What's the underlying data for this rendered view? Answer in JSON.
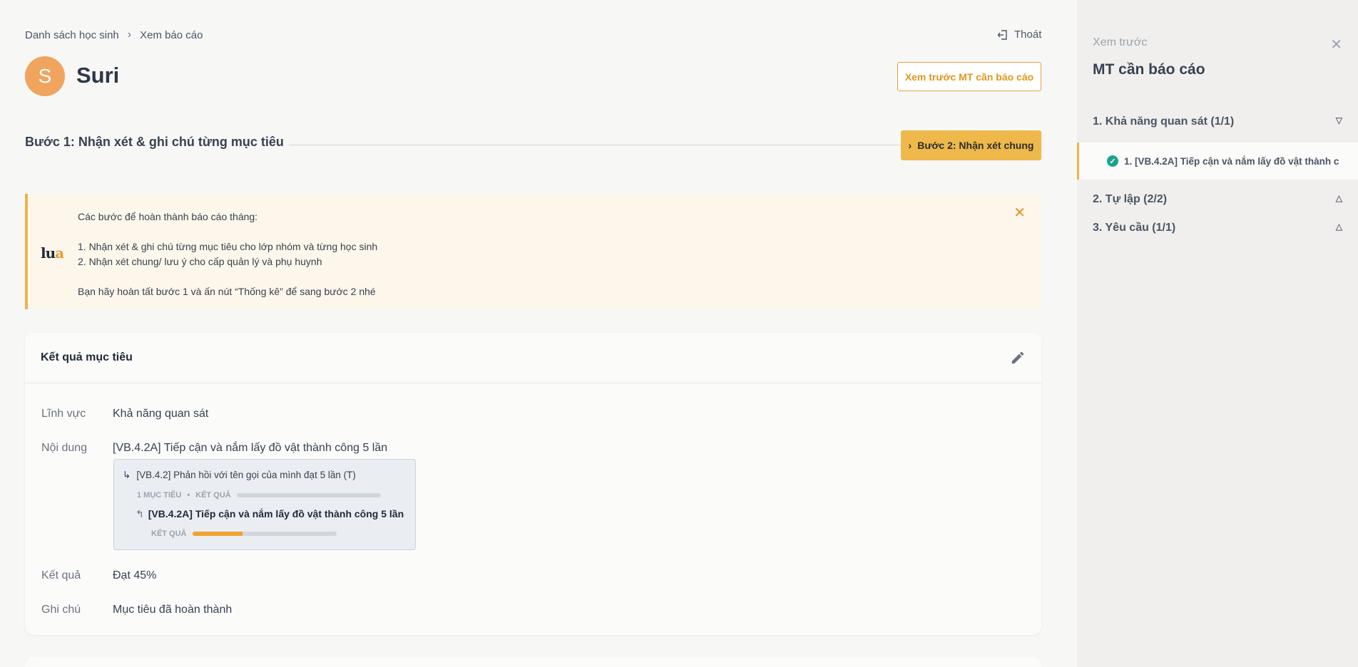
{
  "breadcrumb": {
    "items": [
      "Danh sách học sinh",
      "Xem báo cáo"
    ],
    "separator": "›"
  },
  "header": {
    "logout_label": "Thoát",
    "avatar_initial": "S",
    "student_name": "Suri",
    "preview_button": "Xem trước MT cần báo cáo"
  },
  "steps": {
    "step1_title": "Bước 1: Nhận xét & ghi chú từng mục tiêu",
    "step2_button": "Bước 2: Nhận xét chung"
  },
  "notice": {
    "intro": "Các bước để hoàn thành báo cáo tháng:",
    "item1": "1. Nhận xét & ghi chú từng mục tiêu cho lớp nhóm và từng học sinh",
    "item2": "2. Nhận xét chung/ lưu ý cho cấp quản lý và phụ huynh",
    "outro": "Bạn hãy hoàn tất bước 1 và ấn nút “Thống kê” để sang bước 2 nhé",
    "logo_part1": "lu",
    "logo_part2": "a"
  },
  "result_card": {
    "title": "Kết quả mục tiêu",
    "field_label": "Lĩnh vực",
    "field_value": "Khả năng quan sát",
    "content_label": "Nội dung",
    "content_value": "[VB.4.2A] Tiếp cận và nắm lấy đồ vật thành công 5 lần",
    "tree": {
      "parent": "[VB.4.2] Phản hồi với tên gọi của mình đạt 5 lần (T)",
      "parent_meta_count": "1 MỤC TIÊU",
      "parent_meta_result": "KẾT QUẢ",
      "parent_progress": 0,
      "child": "[VB.4.2A] Tiếp cận và nắm lấy đồ vật thành công 5 lần",
      "child_meta_result": "KẾT QUẢ",
      "child_progress": 35
    },
    "result_label": "Kết quả",
    "result_value": "Đạt 45%",
    "note_label": "Ghi chú",
    "note_value": "Mục tiêu đã hoàn thành"
  },
  "sidebar": {
    "subtitle": "Xem trước",
    "title": "MT cần báo cáo",
    "groups": [
      {
        "label": "1. Khả năng quan sát (1/1)",
        "expanded": true
      },
      {
        "label": "2. Tự lập (2/2)",
        "expanded": false
      },
      {
        "label": "3. Yêu cầu (1/1)",
        "expanded": false
      }
    ],
    "active_item": "1. [VB.4.2A] Tiếp cận và nắm lấy đồ vật thành c"
  },
  "colors": {
    "accent": "#eab54f",
    "avatar": "#f0a45d",
    "success": "#1aa38f"
  }
}
